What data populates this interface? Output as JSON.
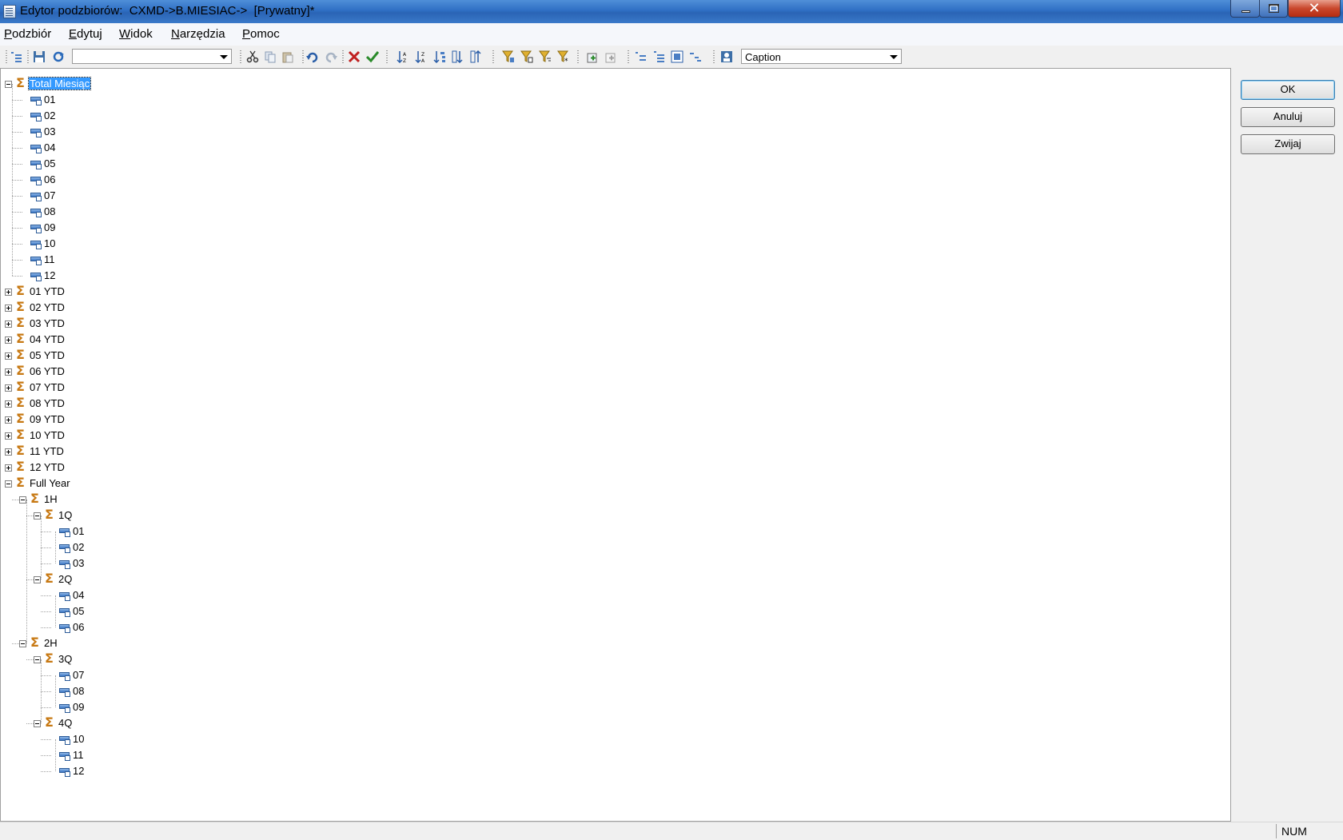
{
  "window": {
    "title": "Edytor podzbiorów:  CXMD->B.MIESIAC->  [Prywatny]*"
  },
  "menu": {
    "items": [
      {
        "accel": "P",
        "rest": "odzbiór"
      },
      {
        "accel": "E",
        "rest": "dytuj"
      },
      {
        "accel": "W",
        "rest": "idok"
      },
      {
        "accel": "N",
        "rest": "arzędzia"
      },
      {
        "accel": "P",
        "rest": "omoc"
      }
    ]
  },
  "toolbar": {
    "filter_combo_value": "",
    "display_combo_value": "Caption",
    "icons": [
      "indent-icon",
      "save-icon",
      "refresh-icon",
      "cut-icon",
      "copy-icon",
      "paste-icon",
      "undo-icon",
      "redo-icon",
      "delete-icon",
      "keep-icon",
      "sort-asc-icon",
      "sort-desc-icon",
      "sort-hierarchy-icon",
      "sort-index-asc-icon",
      "sort-index-desc-icon",
      "filter-icon",
      "filter-attribute-icon",
      "filter-level-icon",
      "filter-wildcard-icon",
      "insert-subset-icon",
      "insert-element-icon",
      "expand-icon",
      "expand-all-icon",
      "collapse-icon",
      "drill-icon",
      "alias-icon"
    ]
  },
  "tree": {
    "nodes": [
      {
        "label": "Total Miesiąc",
        "type": "consolidated",
        "expanded": true,
        "selected": true
      },
      {
        "label": "01",
        "type": "leaf"
      },
      {
        "label": "02",
        "type": "leaf"
      },
      {
        "label": "03",
        "type": "leaf"
      },
      {
        "label": "04",
        "type": "leaf"
      },
      {
        "label": "05",
        "type": "leaf"
      },
      {
        "label": "06",
        "type": "leaf"
      },
      {
        "label": "07",
        "type": "leaf"
      },
      {
        "label": "08",
        "type": "leaf"
      },
      {
        "label": "09",
        "type": "leaf"
      },
      {
        "label": "10",
        "type": "leaf"
      },
      {
        "label": "11",
        "type": "leaf"
      },
      {
        "label": "12",
        "type": "leaf"
      },
      {
        "label": "01 YTD",
        "type": "consolidated",
        "expanded": false
      },
      {
        "label": "02 YTD",
        "type": "consolidated",
        "expanded": false
      },
      {
        "label": "03 YTD",
        "type": "consolidated",
        "expanded": false
      },
      {
        "label": "04 YTD",
        "type": "consolidated",
        "expanded": false
      },
      {
        "label": "05 YTD",
        "type": "consolidated",
        "expanded": false
      },
      {
        "label": "06 YTD",
        "type": "consolidated",
        "expanded": false
      },
      {
        "label": "07 YTD",
        "type": "consolidated",
        "expanded": false
      },
      {
        "label": "08 YTD",
        "type": "consolidated",
        "expanded": false
      },
      {
        "label": "09 YTD",
        "type": "consolidated",
        "expanded": false
      },
      {
        "label": "10 YTD",
        "type": "consolidated",
        "expanded": false
      },
      {
        "label": "11 YTD",
        "type": "consolidated",
        "expanded": false
      },
      {
        "label": "12 YTD",
        "type": "consolidated",
        "expanded": false
      },
      {
        "label": "Full Year",
        "type": "consolidated",
        "expanded": true
      },
      {
        "label": "1H",
        "type": "consolidated",
        "expanded": true
      },
      {
        "label": "1Q",
        "type": "consolidated",
        "expanded": true
      },
      {
        "label": "01",
        "type": "leaf"
      },
      {
        "label": "02",
        "type": "leaf"
      },
      {
        "label": "03",
        "type": "leaf"
      },
      {
        "label": "2Q",
        "type": "consolidated",
        "expanded": true
      },
      {
        "label": "04",
        "type": "leaf"
      },
      {
        "label": "05",
        "type": "leaf"
      },
      {
        "label": "06",
        "type": "leaf"
      },
      {
        "label": "2H",
        "type": "consolidated",
        "expanded": true
      },
      {
        "label": "3Q",
        "type": "consolidated",
        "expanded": true
      },
      {
        "label": "07",
        "type": "leaf"
      },
      {
        "label": "08",
        "type": "leaf"
      },
      {
        "label": "09",
        "type": "leaf"
      },
      {
        "label": "4Q",
        "type": "consolidated",
        "expanded": true
      },
      {
        "label": "10",
        "type": "leaf"
      },
      {
        "label": "11",
        "type": "leaf"
      },
      {
        "label": "12",
        "type": "leaf"
      }
    ]
  },
  "buttons": {
    "ok": "OK",
    "cancel": "Anuluj",
    "collapse": "Zwijaj"
  },
  "status": {
    "num": "NUM"
  }
}
